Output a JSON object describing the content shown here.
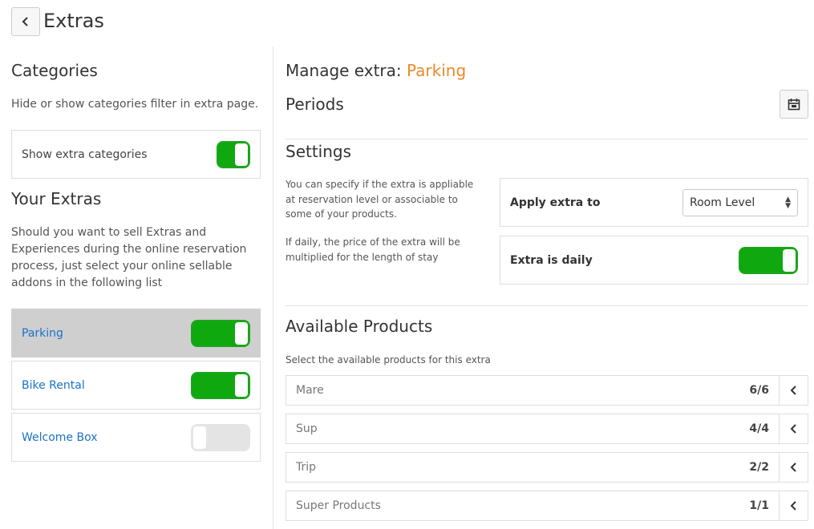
{
  "header": {
    "title": "Extras"
  },
  "categories": {
    "heading": "Categories",
    "description": "Hide or show categories filter in extra page.",
    "toggle_label": "Show extra categories",
    "toggle_on": true
  },
  "your_extras": {
    "heading": "Your Extras",
    "description": "Should you want to sell Extras and Experiences during the online reservation process, just select your online sellable addons in the following list",
    "items": [
      {
        "label": "Parking",
        "enabled": true,
        "selected": true
      },
      {
        "label": "Bike Rental",
        "enabled": true,
        "selected": false
      },
      {
        "label": "Welcome Box",
        "enabled": false,
        "selected": false
      }
    ]
  },
  "manage": {
    "prefix": "Manage extra: ",
    "extra_name": "Parking",
    "periods_heading": "Periods",
    "settings_heading": "Settings",
    "settings_text_1": "You can specify if the extra is appliable at reservation level or associable to some of your products.",
    "settings_text_2": "If daily, the price of the extra will be multiplied for the length of stay",
    "apply_label": "Apply extra to",
    "apply_value": "Room Level",
    "daily_label": "Extra is daily",
    "daily_on": true
  },
  "products": {
    "heading": "Available Products",
    "description": "Select the available products for this extra",
    "rows": [
      {
        "name": "Mare",
        "count": "6/6"
      },
      {
        "name": "Sup",
        "count": "4/4"
      },
      {
        "name": "Trip",
        "count": "2/2"
      },
      {
        "name": "Super Products",
        "count": "1/1"
      }
    ]
  },
  "colors": {
    "accent": "#e98a2a",
    "toggle_on": "#0fa80f",
    "link": "#1a73c9"
  },
  "icons": {
    "back": "chevron-left-icon",
    "calendar": "calendar-icon",
    "row": "chevron-left-icon"
  }
}
